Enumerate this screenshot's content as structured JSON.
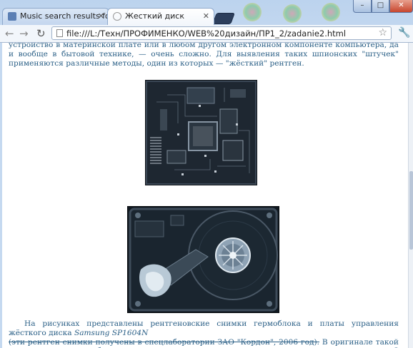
{
  "browser": {
    "tabs": [
      {
        "title": "Music search results for Sys",
        "active": false
      },
      {
        "title": "Жесткий диск",
        "active": true
      }
    ],
    "address": "file:///L:/Техн/ПРОФИМЕНКО/WEB%20дизайн/ПР1_2/zadanie2.html",
    "colors": {
      "accent": "#2a5f86",
      "tab_frame": "#c5d9f0",
      "close": "#c7452d"
    }
  },
  "article": {
    "top_text": "устройство в материнской плате или в любом другом электронном компоненте компьютера, да и вообще в бытовой технике, — очень сложно. Для выявления таких шпионских \"штучек\" применяются различные методы, один из которых — \"жёсткий\" рентген.",
    "bottom_text_1": "На рисунках представлены рентгеновские снимки гермоблока и платы управления жёсткого диска ",
    "bottom_model": "Samsung SP1604N",
    "bottom_strike": "(эти рентген снимки получены в спецлаборатории ЗАО \"Кордон\", 2006 год).",
    "bottom_text_2": " В оригинале такой снимок имеет очень большое разрешение, что позволяет увидеть даже микро-вкрапления. С помощью такого снимка можно выявить"
  }
}
